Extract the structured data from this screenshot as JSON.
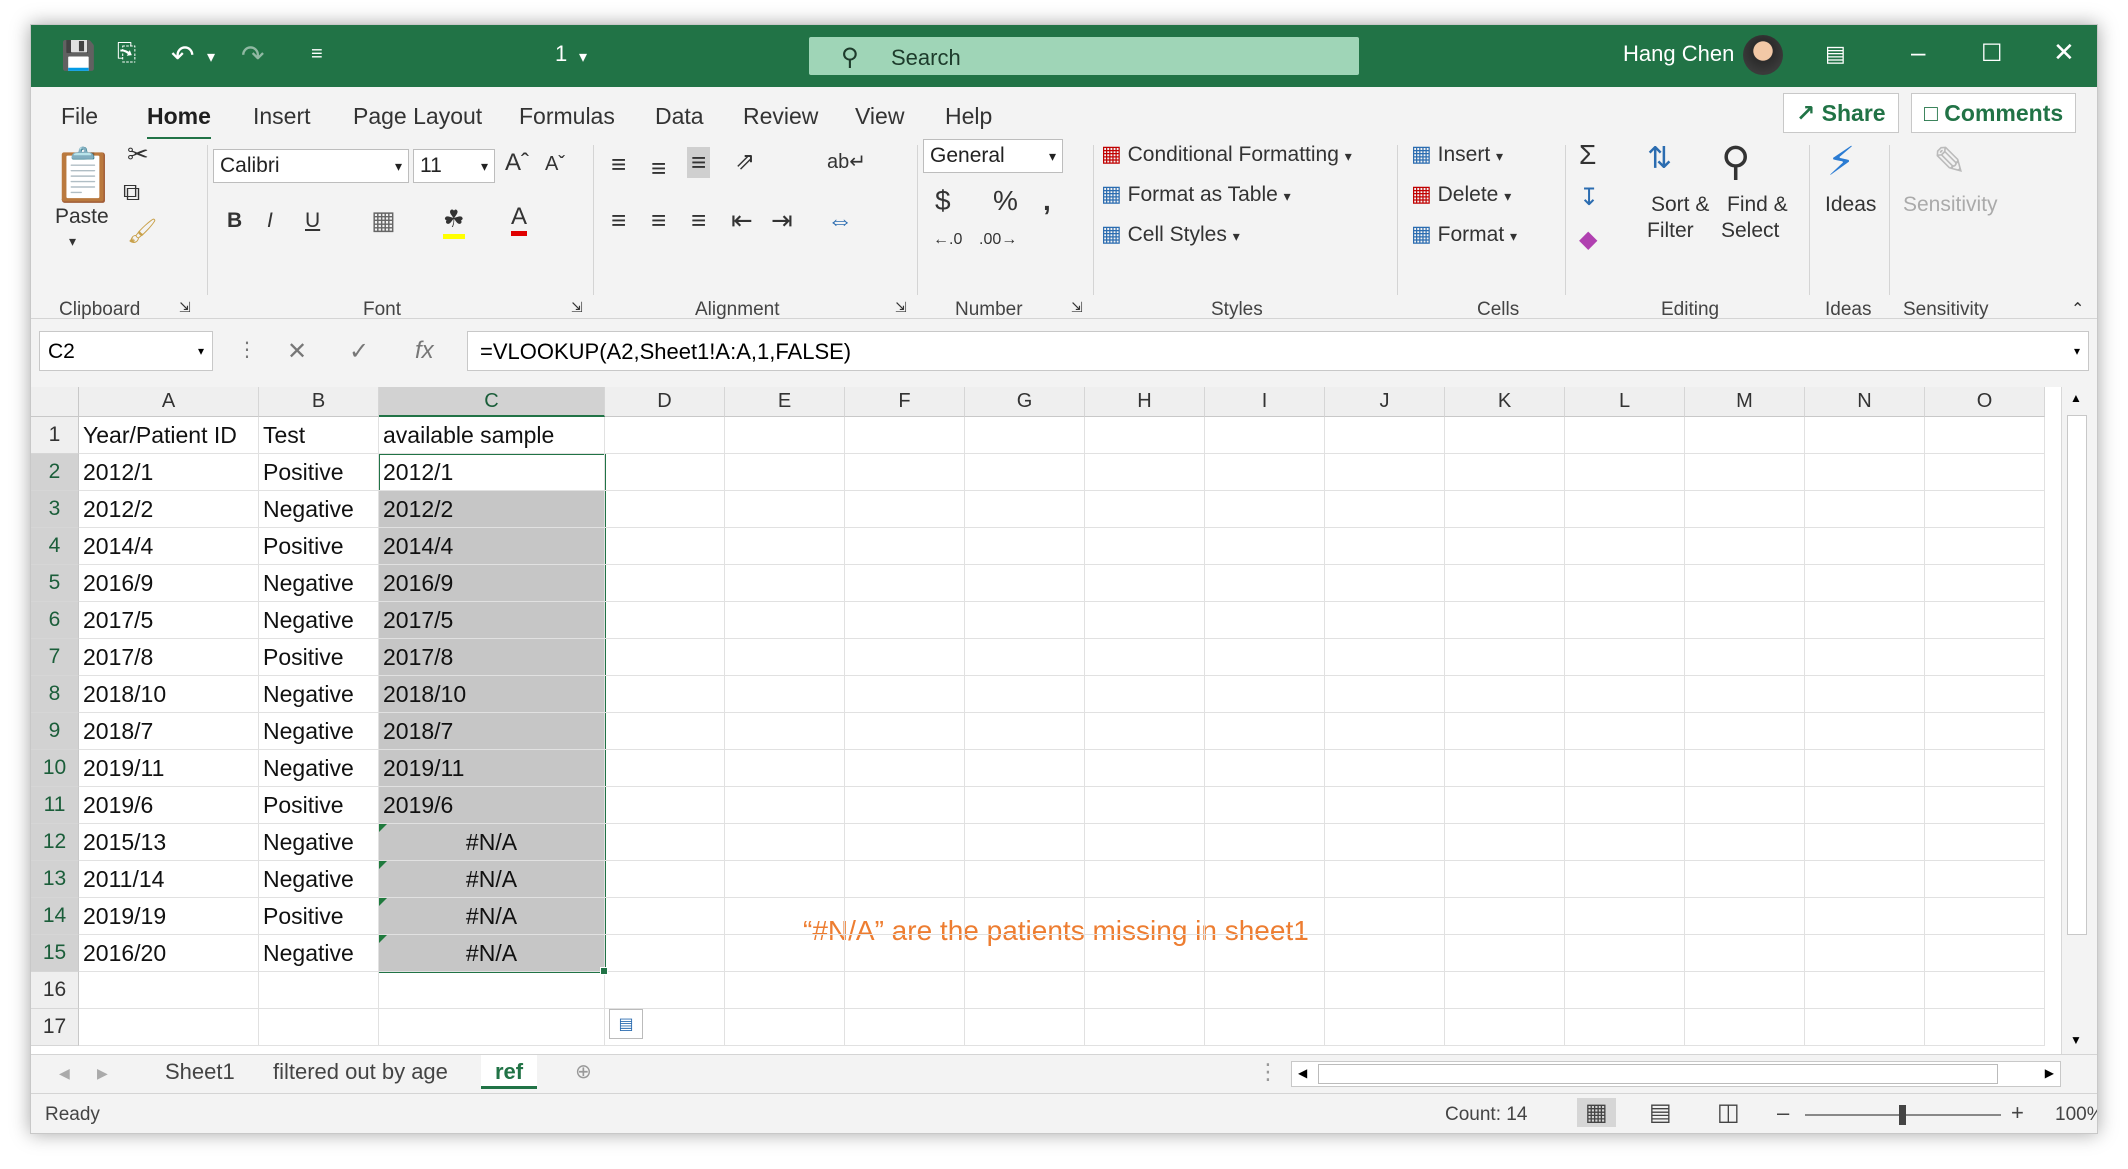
{
  "titlebar": {
    "filename": "1",
    "search_placeholder": "Search",
    "user_name": "Hang Chen"
  },
  "menu": {
    "items": [
      "File",
      "Home",
      "Insert",
      "Page Layout",
      "Formulas",
      "Data",
      "Review",
      "View",
      "Help"
    ],
    "active": "Home",
    "share": "Share",
    "comments": "Comments"
  },
  "ribbon": {
    "clipboard": {
      "paste": "Paste",
      "label": "Clipboard"
    },
    "font": {
      "name": "Calibri",
      "size": "11",
      "label": "Font",
      "bold": "B",
      "italic": "I",
      "underline": "U"
    },
    "alignment": {
      "label": "Alignment"
    },
    "number": {
      "format": "General",
      "label": "Number"
    },
    "styles": {
      "conditional": "Conditional Formatting",
      "format_table": "Format as Table",
      "cell_styles": "Cell Styles",
      "label": "Styles"
    },
    "cells": {
      "insert": "Insert",
      "delete": "Delete",
      "format": "Format",
      "label": "Cells"
    },
    "editing": {
      "sort1": "Sort &",
      "sort2": "Filter",
      "find1": "Find &",
      "find2": "Select",
      "label": "Editing"
    },
    "ideas": {
      "btn": "Ideas",
      "label": "Ideas"
    },
    "sensitivity": {
      "btn": "Sensitivity",
      "label": "Sensitivity"
    }
  },
  "formula_bar": {
    "name_box": "C2",
    "formula": "=VLOOKUP(A2,Sheet1!A:A,1,FALSE)"
  },
  "sheet": {
    "columns": [
      "A",
      "B",
      "C",
      "D",
      "E",
      "F",
      "G",
      "H",
      "I",
      "J",
      "K",
      "L",
      "M",
      "N",
      "O"
    ],
    "rows": [
      [
        "Year/Patient ID",
        "Test",
        "available sample"
      ],
      [
        "2012/1",
        "Positive",
        "2012/1"
      ],
      [
        "2012/2",
        "Negative",
        "2012/2"
      ],
      [
        "2014/4",
        "Positive",
        "2014/4"
      ],
      [
        "2016/9",
        "Negative",
        "2016/9"
      ],
      [
        "2017/5",
        "Negative",
        "2017/5"
      ],
      [
        "2017/8",
        "Positive",
        "2017/8"
      ],
      [
        "2018/10",
        "Negative",
        "2018/10"
      ],
      [
        "2018/7",
        "Negative",
        "2018/7"
      ],
      [
        "2019/11",
        "Negative",
        "2019/11"
      ],
      [
        "2019/6",
        "Positive",
        "2019/6"
      ],
      [
        "2015/13",
        "Negative",
        "#N/A"
      ],
      [
        "2011/14",
        "Negative",
        "#N/A"
      ],
      [
        "2019/19",
        "Positive",
        "#N/A"
      ],
      [
        "2016/20",
        "Negative",
        "#N/A"
      ],
      [
        "",
        "",
        ""
      ],
      [
        "",
        "",
        ""
      ]
    ],
    "annotation": "“#N/A”  are the patients missing in sheet1"
  },
  "tabs": [
    "Sheet1",
    "filtered out by age",
    "ref"
  ],
  "active_tab": "ref",
  "status": {
    "ready": "Ready",
    "count": "Count: 14",
    "zoom": "100%"
  },
  "colors": {
    "accent": "#217346",
    "annotation": "#ed7d31"
  }
}
